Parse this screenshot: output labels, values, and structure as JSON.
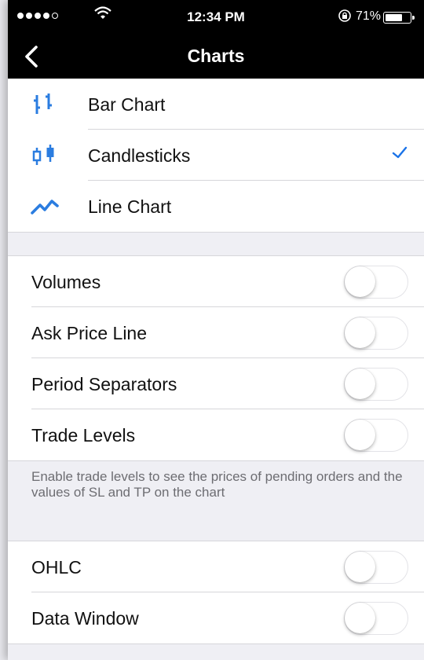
{
  "status_bar": {
    "time": "12:34 PM",
    "battery_text": "71%",
    "battery_level": 0.71,
    "signal_bars_filled": 4,
    "signal_bars_total": 5,
    "icons": [
      "signal-dots-icon",
      "wifi-icon",
      "orientation-lock-icon",
      "battery-icon"
    ]
  },
  "nav": {
    "title": "Charts",
    "back_icon": "chevron-left-icon"
  },
  "chart_types": [
    {
      "label": "Bar Chart",
      "icon": "bar-chart-icon",
      "selected": false
    },
    {
      "label": "Candlesticks",
      "icon": "candlesticks-icon",
      "selected": true
    },
    {
      "label": "Line Chart",
      "icon": "line-chart-icon",
      "selected": false
    }
  ],
  "toggles_group1": [
    {
      "label": "Volumes",
      "on": false
    },
    {
      "label": "Ask Price Line",
      "on": false
    },
    {
      "label": "Period Separators",
      "on": false
    },
    {
      "label": "Trade Levels",
      "on": false
    }
  ],
  "footer_note": "Enable trade levels to see the prices of pending orders and the values of SL and TP on the chart",
  "toggles_group2": [
    {
      "label": "OHLC",
      "on": false
    },
    {
      "label": "Data Window",
      "on": false
    }
  ],
  "colors": {
    "accent": "#1a73e8",
    "icon_blue": "#2b7de0",
    "nav_bg": "#000000",
    "group_bg": "#efeff4"
  }
}
